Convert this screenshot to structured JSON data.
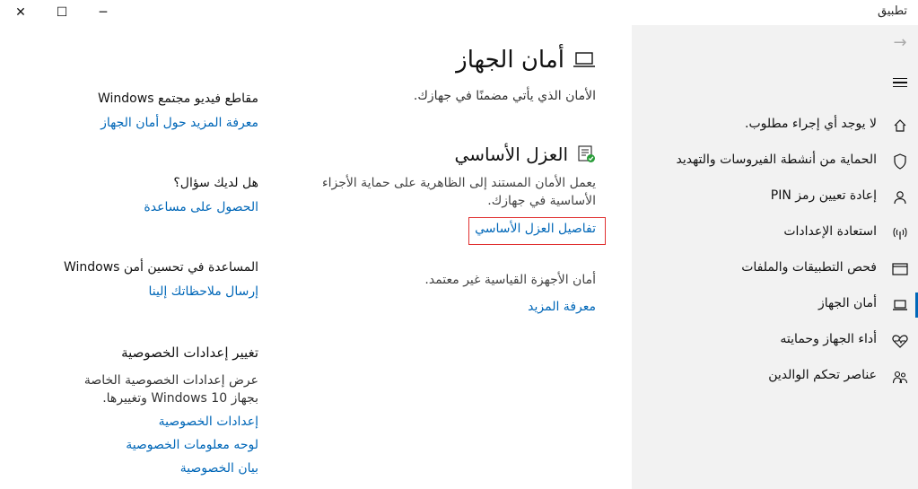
{
  "window": {
    "title": "تطبيق",
    "close_glyph": "✕",
    "maximize_glyph": "☐",
    "minimize_glyph": "─"
  },
  "sidebar": {
    "back_glyph": "→",
    "active_index": 4,
    "items": [
      {
        "label": "لا يوجد أي إجراء مطلوب.",
        "icon": "home-icon"
      },
      {
        "label": "الحماية من أنشطة الفيروسات والتهديد",
        "icon": "shield-icon"
      },
      {
        "label": "إعادة تعيين رمز PIN",
        "icon": "person-icon"
      },
      {
        "label": "استعادة الإعدادات",
        "icon": "wireless-icon"
      },
      {
        "label": "فحص التطبيقات والملفات",
        "icon": "browser-window-icon"
      },
      {
        "label": "أمان الجهاز",
        "icon": "laptop-icon"
      },
      {
        "label": "أداء الجهاز وحمايته",
        "icon": "heart-icon"
      },
      {
        "label": "عناصر تحكم الوالدين",
        "icon": "family-icon"
      }
    ]
  },
  "main": {
    "title": "أمان الجهاز",
    "subtitle": "الأمان الذي يأتي مضمنًا في جهازك.",
    "core_isolation": {
      "heading": "العزل الأساسي",
      "desc_line1": "يعمل الأمان المستند إلى الظاهرية على حماية الأجزاء",
      "desc_line2": "الأساسية في جهازك.",
      "details_link": "تفاصيل العزل الأساسي"
    },
    "hardware": {
      "text": "أمان الأجهزة القياسية غير معتمد.",
      "link": "معرفة المزيد"
    }
  },
  "right_column": {
    "videos": {
      "heading": "مقاطع فيديو مجتمع Windows",
      "link": "معرفة المزيد حول أمان الجهاز"
    },
    "question": {
      "heading": "هل لديك سؤال؟",
      "link": "الحصول على مساعدة"
    },
    "improve": {
      "heading": "المساعدة في تحسين أمن Windows",
      "link": "إرسال ملاحظاتك إلينا"
    },
    "privacy": {
      "heading": "تغيير إعدادات الخصوصية",
      "text_line1": "عرض إعدادات الخصوصية الخاصة",
      "text_line2": "بجهاز Windows 10 وتغييرها.",
      "links": [
        "إعدادات الخصوصية",
        "لوحه معلومات الخصوصية",
        "بيان الخصوصية"
      ]
    }
  },
  "colors": {
    "accent": "#0067b8",
    "sidebar_bg": "#f2f2f2",
    "highlight_box": "#e03030",
    "check_green": "#2a9d3a"
  }
}
